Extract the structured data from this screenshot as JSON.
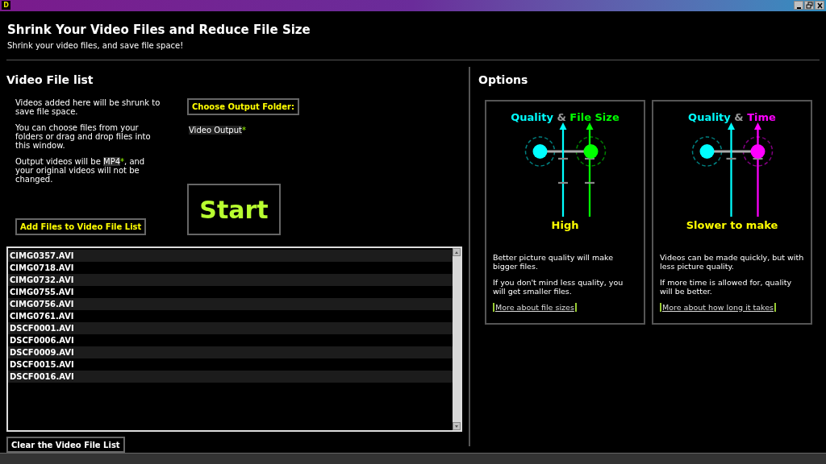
{
  "window": {
    "icon_letter": "D",
    "title": "Shrink Your Video Files and Reduce File Size",
    "subtitle": "Shrink your video files, and save file space!"
  },
  "file_list": {
    "heading": "Video File list",
    "info": [
      {
        "text": "Videos added here will be shrunk to save file space."
      },
      {
        "text": "You can choose files from your folders or drag and drop files into this window."
      },
      {
        "before": "Output videos will be ",
        "highlight": "MP4",
        "mark": "*",
        "after": ", and your original videos will not be changed."
      }
    ],
    "choose_folder_button": "Choose Output Folder:",
    "output_folder": {
      "highlight": "Video Output",
      "mark": "*"
    },
    "start_button": "Start",
    "add_button": "Add Files to Video File List",
    "files": [
      "CIMG0357.AVI",
      "CIMG0718.AVI",
      "CIMG0732.AVI",
      "CIMG0755.AVI",
      "CIMG0756.AVI",
      "CIMG0761.AVI",
      "DSCF0001.AVI",
      "DSCF0006.AVI",
      "DSCF0009.AVI",
      "DSCF0015.AVI",
      "DSCF0016.AVI"
    ],
    "clear_button": "Clear the Video File List"
  },
  "options": {
    "heading": "Options",
    "cards": [
      {
        "kind": "file_size",
        "first": "Quality",
        "joiner": "&",
        "second": "File Size",
        "reading": "High",
        "paragraphs": [
          "Better picture quality will make bigger files.",
          "If you don't mind less quality, you will get smaller files."
        ],
        "link": "More about file sizes"
      },
      {
        "kind": "time",
        "first": "Quality",
        "joiner": "&",
        "second": "Time",
        "reading": "Slower to make",
        "paragraphs": [
          "Videos can be made quickly, but with less picture quality.",
          "If more time is allowed for, quality will be better."
        ],
        "link": "More about how long it takes"
      }
    ]
  }
}
